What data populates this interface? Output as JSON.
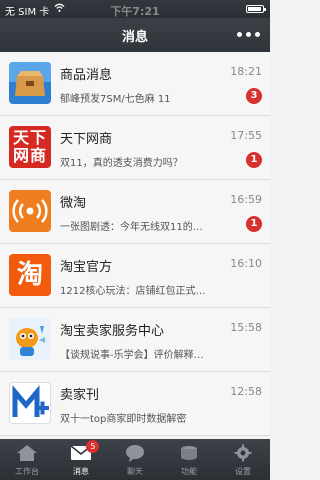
{
  "status": {
    "carrier": "无 SIM 卡",
    "time": "下午7:21"
  },
  "header": {
    "title": "消息"
  },
  "messages": [
    {
      "name": "商品消息",
      "time": "18:21",
      "preview": "郁峰预发7SM/七色麻 11",
      "badge": "3",
      "icon": "package-icon"
    },
    {
      "name": "天下网商",
      "time": "17:55",
      "preview": "双11，真的透支消费力吗？",
      "badge": "1",
      "icon": "tianxia-logo-icon",
      "logo_text": "天下网商"
    },
    {
      "name": "微淘",
      "time": "16:59",
      "preview": "一张图剧透：今年无线双11的…",
      "badge": "1",
      "icon": "broadcast-icon"
    },
    {
      "name": "淘宝官方",
      "time": "16:10",
      "preview": "1212核心玩法：店铺红包正式…",
      "badge": "",
      "icon": "taobao-logo-icon",
      "logo_text": "淘"
    },
    {
      "name": "淘宝卖家服务中心",
      "time": "15:58",
      "preview": "【谈规说事-乐学会】评价解释…",
      "badge": "",
      "icon": "mascot-icon"
    },
    {
      "name": "卖家刊",
      "time": "12:58",
      "preview": "双十一top商家即时数据解密",
      "badge": "",
      "icon": "m-plus-logo-icon"
    }
  ],
  "tabs": [
    {
      "label": "工作台",
      "icon": "workbench-icon",
      "badge": ""
    },
    {
      "label": "消息",
      "icon": "envelope-icon",
      "badge": "5",
      "active": true
    },
    {
      "label": "聊天",
      "icon": "chat-icon",
      "badge": ""
    },
    {
      "label": "功能",
      "icon": "functions-icon",
      "badge": ""
    },
    {
      "label": "设置",
      "icon": "gear-icon",
      "badge": ""
    }
  ],
  "colors": {
    "badge": "#d8302f",
    "bar": "#33383e",
    "accent_orange": "#f07d1f",
    "tianxia_red": "#d42a22",
    "taobao_orange": "#f25a0c",
    "maijiakan_blue": "#1f66c9"
  }
}
